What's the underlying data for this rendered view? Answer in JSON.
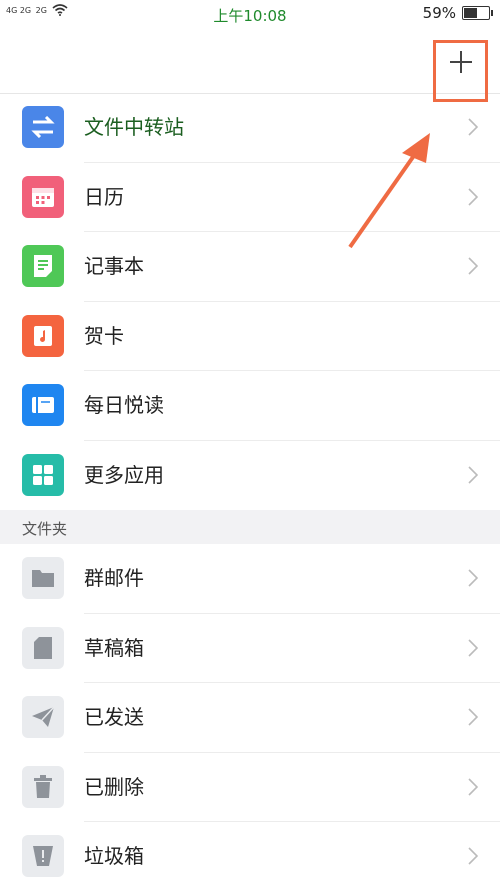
{
  "status_bar": {
    "signal_1": "4G 2G",
    "signal_2": "2G",
    "time": "上午10:08",
    "battery": "59%",
    "battery_level": 0.59
  },
  "header": {
    "add_label": "+"
  },
  "apps": [
    {
      "label": "文件中转站",
      "icon": "transfer-icon",
      "color": "#4a86e8",
      "has_chevron": true
    },
    {
      "label": "日历",
      "icon": "calendar-icon",
      "color": "#f1607a",
      "has_chevron": true
    },
    {
      "label": "记事本",
      "icon": "notepad-icon",
      "color": "#4fc857",
      "has_chevron": true
    },
    {
      "label": "贺卡",
      "icon": "greeting-card-icon",
      "color": "#f4643f",
      "has_chevron": false
    },
    {
      "label": "每日悦读",
      "icon": "daily-reading-icon",
      "color": "#1f86f0",
      "has_chevron": false
    },
    {
      "label": "更多应用",
      "icon": "more-apps-icon",
      "color": "#26bca8",
      "has_chevron": true
    }
  ],
  "folders_section": {
    "title": "文件夹"
  },
  "folders": [
    {
      "label": "群邮件",
      "icon": "folder-icon"
    },
    {
      "label": "草稿箱",
      "icon": "draft-icon"
    },
    {
      "label": "已发送",
      "icon": "sent-icon"
    },
    {
      "label": "已删除",
      "icon": "trash-icon"
    },
    {
      "label": "垃圾箱",
      "icon": "spam-icon"
    }
  ],
  "colors": {
    "accent_annotation": "#ef6b43",
    "time_green": "#1f8a2c",
    "folder_icon_bg": "#e9ebee"
  }
}
